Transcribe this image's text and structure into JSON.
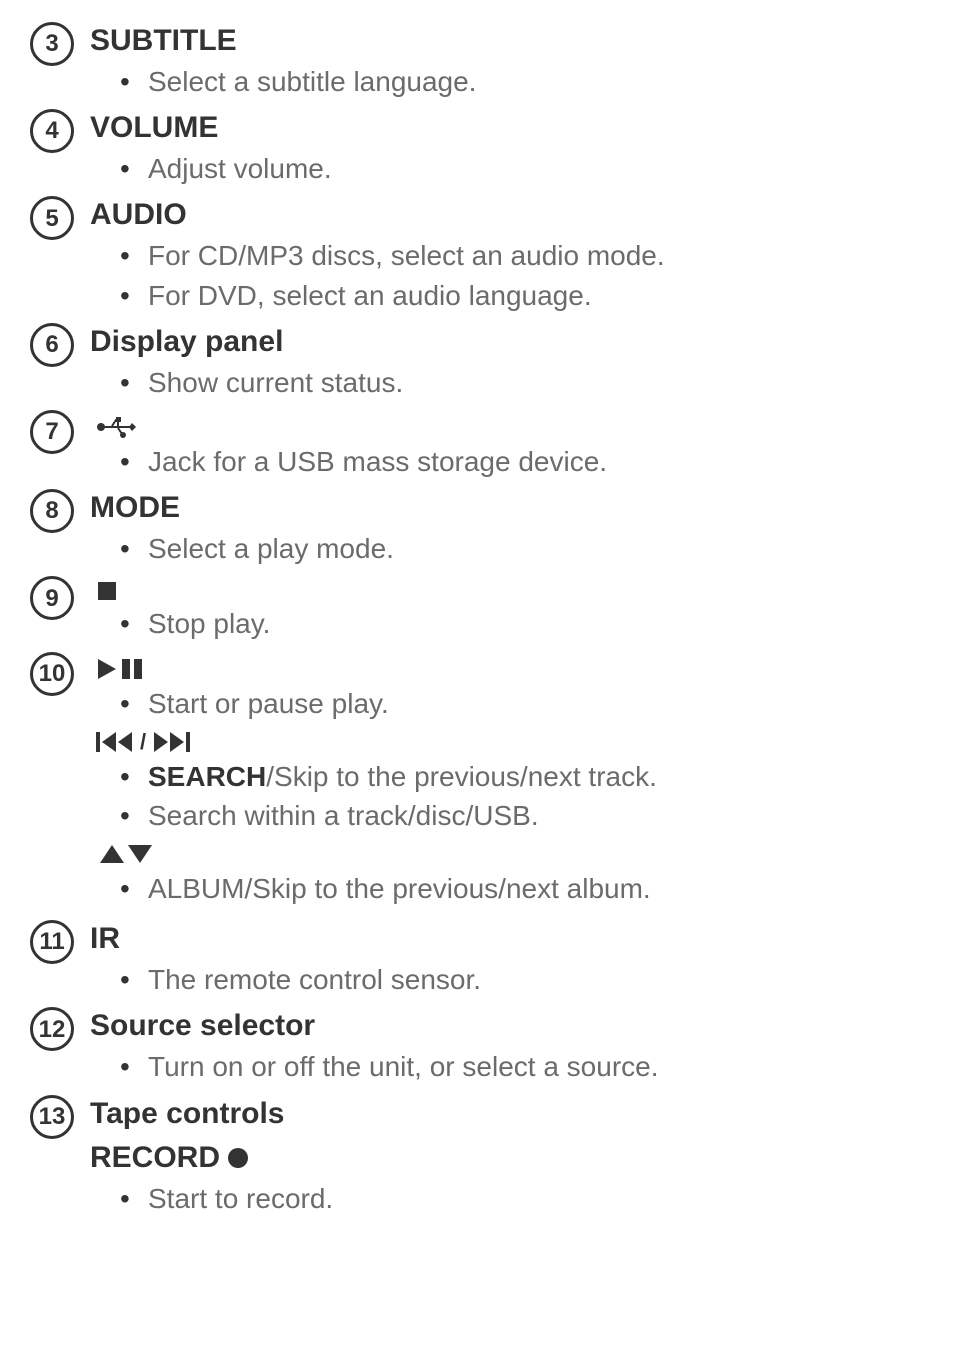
{
  "items": {
    "3": {
      "title": "SUBTITLE",
      "bullets": [
        "Select a subtitle language."
      ]
    },
    "4": {
      "title": "VOLUME",
      "bullets": [
        "Adjust volume."
      ]
    },
    "5": {
      "title": "AUDIO",
      "bullets": [
        "For CD/MP3 discs, select an audio mode.",
        "For DVD, select an audio language."
      ]
    },
    "6": {
      "title": "Display panel",
      "bullets": [
        "Show current status."
      ]
    },
    "7": {
      "icon": "usb",
      "bullets": [
        "Jack for a USB mass storage device."
      ]
    },
    "8": {
      "title": "MODE",
      "bullets": [
        "Select a play mode."
      ]
    },
    "9": {
      "icon": "stop",
      "bullets": [
        "Stop play."
      ]
    },
    "10": {
      "icon": "playpause",
      "bullets": [
        "Start or pause play."
      ],
      "sub": [
        {
          "icon": "prevnext",
          "bullets": [
            {
              "lead": "SEARCH",
              "text": "/Skip to the previous/next track."
            },
            {
              "text": "Search within a track/disc/USB."
            }
          ]
        },
        {
          "icon": "updown",
          "bullets": [
            {
              "text": "ALBUM/Skip to the previous/next album."
            }
          ]
        }
      ]
    },
    "11": {
      "title": "IR",
      "bullets": [
        "The remote control sensor."
      ]
    },
    "12": {
      "title": "Source selector",
      "bullets": [
        "Turn on or off the unit, or select a source."
      ]
    },
    "13": {
      "title": "Tape controls",
      "subtitle": "RECORD",
      "subtitle_icon": "record",
      "bullets": [
        "Start to record."
      ]
    }
  },
  "markers": {
    "3": "3",
    "4": "4",
    "5": "5",
    "6": "6",
    "7": "7",
    "8": "8",
    "9": "9",
    "10": "10",
    "11": "11",
    "12": "12",
    "13": "13"
  }
}
